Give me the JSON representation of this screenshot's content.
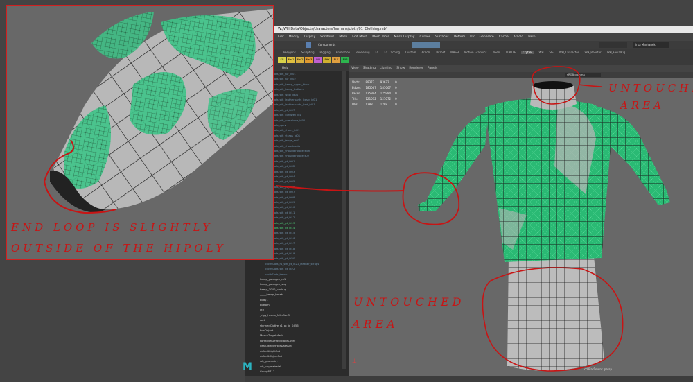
{
  "window_title": "W:/WH Data/Objects/characters/humans/cloth/01_Clothing.mb*",
  "menus": [
    "Edit",
    "Modify",
    "Display",
    "Windows",
    "Mesh",
    "Edit Mesh",
    "Mesh Tools",
    "Mesh Display",
    "Curves",
    "Surfaces",
    "Deform",
    "UV",
    "Generate",
    "Cache",
    "Arnold",
    "Help"
  ],
  "status": {
    "object_field": "Components",
    "user": "Jirka Marhanek"
  },
  "shelf_tabs": [
    "Polygons",
    "Sculpting",
    "Rigging",
    "Animation",
    "Rendering",
    "FX",
    "FX Caching",
    "Custom",
    "Arnold",
    "Bifrost",
    "MASH",
    "Motion Graphics",
    "XGen",
    "TURTLE",
    "Crytek",
    "WH",
    "SIE",
    "WH_Character",
    "WH_Rooster",
    "WH_FacialRig"
  ],
  "shelf_active": "Crytek",
  "shelf_buttons": [
    "SG",
    "Mat1",
    "Mat2",
    "Mat3",
    "WP",
    "PHY",
    "BLK",
    "EXP"
  ],
  "outliner": {
    "menu": [
      "Help"
    ],
    "items": [
      "clothSlots_sth_fur_id01",
      "clothSlots_sth_fur_id02",
      "clothSlots_sth_hemp_upper_thick",
      "clothSlots_sth_hemp_bottom",
      "clothSlots_sth_wool_id01",
      "clothSlots_sth_leatherpants_basic_id01",
      "clothSlots_sth_leatherpants_bad_id01",
      "clothSlots_sth_pt_id07",
      "clothSlots_sth_cordwell_id1",
      "clothSlots_sth_overalone_id01",
      "clothSlots_dpcv",
      "clothSlots_sth_shoes_id01",
      "clothSlots_sth_straps_id01",
      "clothSlots_sth_fangs_m01",
      "clothSlots_sth_shoudspots",
      "clothSlots_sth_shoulderprotection",
      "clothSlots_sth_shoulderprotect02",
      "clothSlots_sth_pt_id01",
      "clothSlots_sth_pt_id02",
      "clothSlots_sth_pt_id03",
      "clothSlots_sth_pt_id04",
      "clothSlots_sth_pt_id05",
      "clothSlots_sth_pt_id06",
      "clothSlots_sth_pt_id07",
      "clothSlots_sth_pt_id08",
      "clothSlots_sth_pt_id09",
      "clothSlots_sth_pt_id10",
      "clothSlots_sth_pt_id11",
      "clothSlots_sth_pt_id12",
      "clothSlots_sth_pt_id13",
      "clothSlots_sth_pt_id14",
      "clothSlots_sth_pt_id15",
      "clothSlots_sth_pt_id16",
      "clothSlots_sth_pt_id17",
      "clothSlots_sth_pt_id18",
      "clothSlots_sth_pt_id19",
      "clothSlots_sth_pt_id20",
      "clothSlots_r1_sth_pt_id21_leather_straps",
      "clothSlots_sth_pt_id22",
      "clothSlots_hemp",
      "hemp_youngen_m1",
      "hemp_youngen_vag",
      "hemp_1040_backup",
      "_____hemp_break",
      "body1",
      "bottom",
      "ctrl",
      "_rigg_heads_fullnGen3",
      "rock",
      "skinnedClothe_r1_pt_id_0456",
      "boxObject",
      "MorphTargetMesh",
      "ForModelDefaultBakeLayer",
      "defaultHideFaceDataSet",
      "defaultLightSet",
      "defaultObjectSet",
      "wh_geometry",
      "wh_phymaterial",
      "Group8717"
    ],
    "highlighted": [
      29,
      30
    ]
  },
  "viewport": {
    "menu": [
      "View",
      "Shading",
      "Lighting",
      "Show",
      "Renderer",
      "Panels"
    ],
    "hud": [
      {
        "label": "Verts:",
        "v1": "89373",
        "v2": "93672",
        "v3": "0"
      },
      {
        "label": "Edges:",
        "v1": "185067",
        "v2": "185067",
        "v3": "0"
      },
      {
        "label": "Faces:",
        "v1": "125994",
        "v2": "125994",
        "v3": "0"
      },
      {
        "label": "Tris:",
        "v1": "121072",
        "v2": "121072",
        "v3": "0"
      },
      {
        "label": "UVs:",
        "v1": "1288",
        "v2": "1288",
        "v3": "0"
      }
    ],
    "gamma": "sRGB gamma",
    "camera": "cd PlatDown : persp"
  },
  "annotations": {
    "inset_note_line1": "END LOOP IS SLIGHTLY",
    "inset_note_line2": "OUTSIDE OF THE HIPOLY",
    "top_right_line1": "UNTOUCHED",
    "top_right_line2": "AREA",
    "bottom_line1": "UNTOUCHED",
    "bottom_line2": "AREA"
  },
  "colors": {
    "annotation_red": "#c81414",
    "wire_green": "#1ec07a",
    "mesh_grey": "#b5b5b5"
  }
}
